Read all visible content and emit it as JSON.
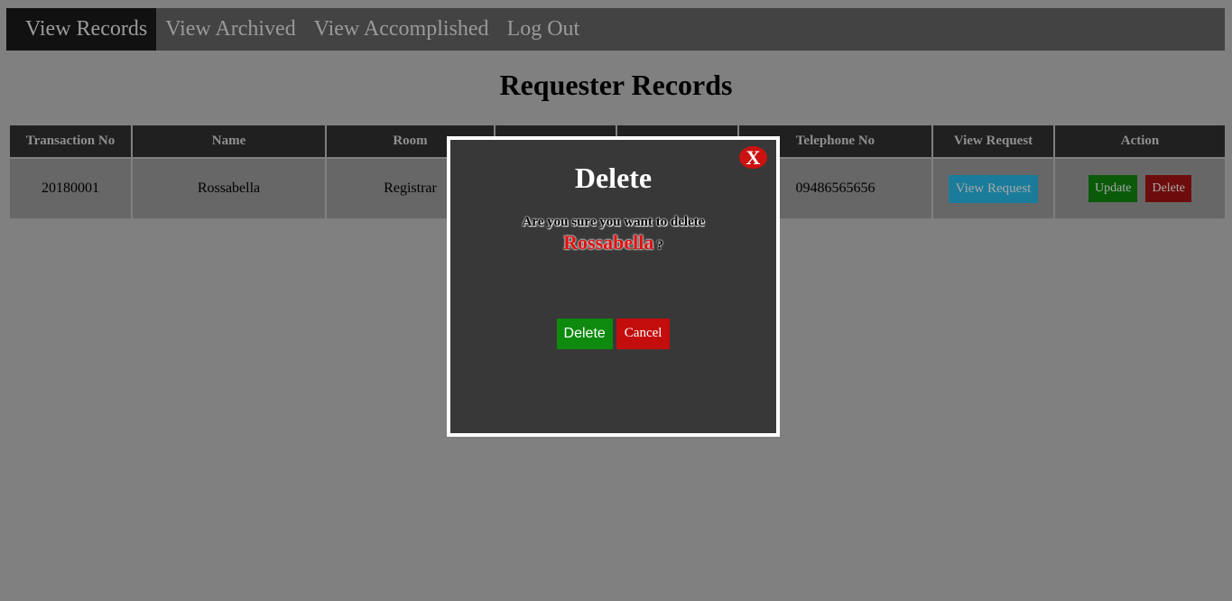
{
  "nav": {
    "items": [
      {
        "label": "View Records"
      },
      {
        "label": "View Archived"
      },
      {
        "label": "View Accomplished"
      },
      {
        "label": "Log Out"
      }
    ]
  },
  "page": {
    "title": "Requester Records"
  },
  "table": {
    "headers": [
      "Transaction No",
      "Name",
      "Room",
      "",
      "",
      "Telephone No",
      "View Request",
      "Action"
    ],
    "rows": [
      {
        "transaction_no": "20180001",
        "name": "Rossabella",
        "room": "Registrar",
        "col4": "",
        "col5": "",
        "telephone": "09486565656",
        "view_request_label": "View Request",
        "update_label": "Update",
        "delete_label": "Delete"
      }
    ]
  },
  "modal": {
    "close_label": "X",
    "title": "Delete",
    "question": "Are you sure you want to delete",
    "name": "Rossabella",
    "qmark": "?",
    "delete_label": "Delete",
    "cancel_label": "Cancel"
  },
  "colors": {
    "overlay_bg": "#808080",
    "modal_bg": "#383838",
    "danger": "#c40d0d",
    "success": "#0e8a0e",
    "info": "#1a7c9a"
  }
}
